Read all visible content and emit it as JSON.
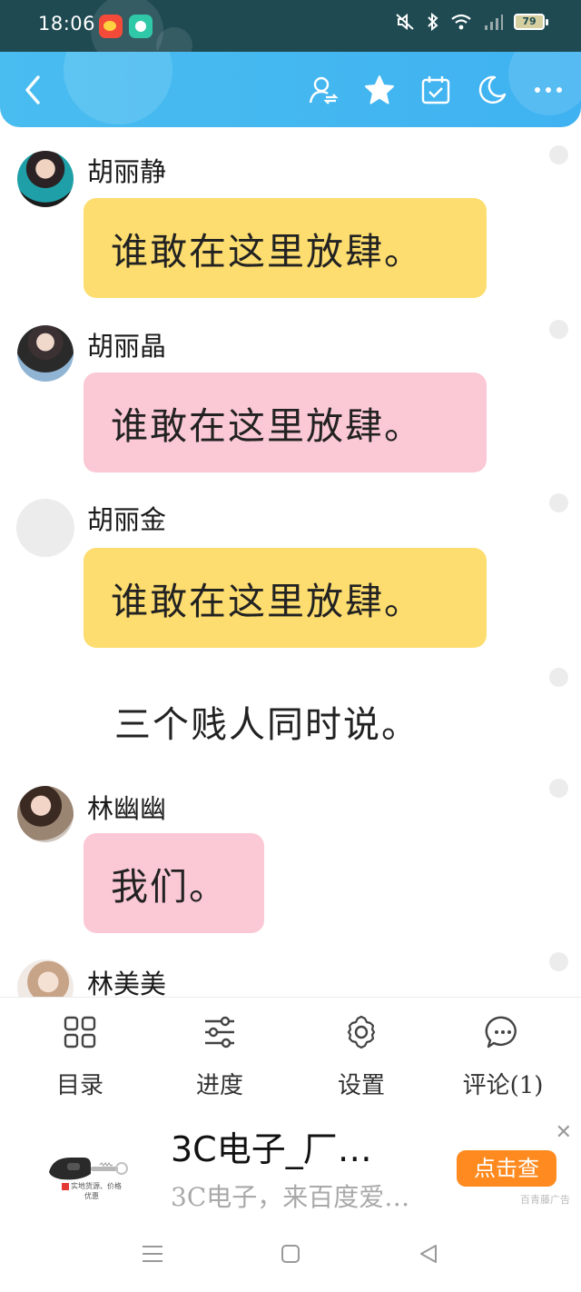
{
  "status_bar": {
    "time": "18:06",
    "battery": "79",
    "icons": [
      "weibo-app-icon",
      "chat-app-icon",
      "mute-icon",
      "bluetooth-icon",
      "wifi-icon",
      "signal-icon",
      "battery-icon"
    ]
  },
  "header": {
    "actions": [
      "user-switch-icon",
      "star-icon",
      "calendar-check-icon",
      "night-mode-icon",
      "more-icon"
    ]
  },
  "messages": [
    {
      "type": "chat",
      "name": "胡丽静",
      "text": "谁敢在这里放肆。",
      "bubble": "yellow",
      "avatar": "photo"
    },
    {
      "type": "chat",
      "name": "胡丽晶",
      "text": "谁敢在这里放肆。",
      "bubble": "pink",
      "avatar": "photo"
    },
    {
      "type": "chat",
      "name": "胡丽金",
      "text": "谁敢在这里放肆。",
      "bubble": "yellow",
      "avatar": "placeholder"
    },
    {
      "type": "narration",
      "text": "三个贱人同时说。"
    },
    {
      "type": "chat",
      "name": "林幽幽",
      "text": "我们。",
      "bubble": "pink",
      "avatar": "photo"
    },
    {
      "type": "chat",
      "name": "林美美",
      "text": "",
      "avatar": "photo"
    }
  ],
  "toolbar": {
    "items": [
      {
        "label": "目录",
        "icon": "grid-icon"
      },
      {
        "label": "进度",
        "icon": "sliders-icon"
      },
      {
        "label": "设置",
        "icon": "gear-icon"
      },
      {
        "label": "评论(1)",
        "icon": "comment-icon"
      }
    ]
  },
  "ad": {
    "title": "3C电子_厂…",
    "subtitle": "3C电子，来百度爱…",
    "cta": "点击查",
    "tag": "百青藤广告",
    "thumb_caption": "实地货源、价格优惠"
  },
  "colors": {
    "header": "#45b8f0",
    "bubble_yellow": "#fddd6f",
    "bubble_pink": "#fbc8d5",
    "cta": "#ff8a1f"
  }
}
